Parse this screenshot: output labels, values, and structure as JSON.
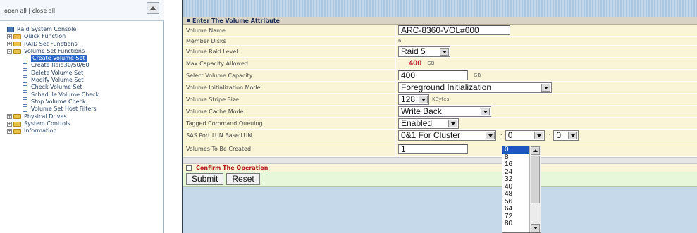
{
  "nav": {
    "open_all": "open all",
    "separator": "|",
    "close_all": "close all",
    "tree": [
      {
        "label": "Raid System Console",
        "type": "root",
        "icon": "computer-icon"
      },
      {
        "label": "Quick Function",
        "type": "folder",
        "expand": "+"
      },
      {
        "label": "RAID Set Functions",
        "type": "folder",
        "expand": "+"
      },
      {
        "label": "Volume Set Functions",
        "type": "folder",
        "expand": "-"
      },
      {
        "label": "Create Volume Set",
        "type": "page",
        "active": true
      },
      {
        "label": "Create Raid30/50/60",
        "type": "page"
      },
      {
        "label": "Delete Volume Set",
        "type": "page"
      },
      {
        "label": "Modify Volume Set",
        "type": "page"
      },
      {
        "label": "Check Volume Set",
        "type": "page"
      },
      {
        "label": "Schedule Volume Check",
        "type": "page"
      },
      {
        "label": "Stop Volume Check",
        "type": "page"
      },
      {
        "label": "Volume Set Host Filters",
        "type": "page"
      },
      {
        "label": "Physical Drives",
        "type": "folder",
        "expand": "+"
      },
      {
        "label": "System Controls",
        "type": "folder",
        "expand": "+"
      },
      {
        "label": "Information",
        "type": "folder",
        "expand": "+"
      }
    ]
  },
  "form": {
    "section_title": "Enter The Volume Attribute",
    "rows": {
      "volume_name": {
        "label": "Volume Name",
        "value": "ARC-8360-VOL#000"
      },
      "member_disks": {
        "label": "Member Disks",
        "value": "6"
      },
      "raid_level": {
        "label": "Volume Raid Level",
        "value": "Raid 5"
      },
      "max_capacity": {
        "label": "Max Capacity Allowed",
        "value": "400",
        "unit": "GB"
      },
      "select_capacity": {
        "label": "Select Volume Capacity",
        "value": "400",
        "unit": "GB"
      },
      "init_mode": {
        "label": "Volume Initialization Mode",
        "value": "Foreground Initialization"
      },
      "stripe_size": {
        "label": "Volume Stripe Size",
        "value": "128",
        "unit": "KBytes"
      },
      "cache_mode": {
        "label": "Volume Cache Mode",
        "value": "Write Back"
      },
      "tcq": {
        "label": "Tagged Command Queuing",
        "value": "Enabled"
      },
      "sas_port": {
        "label": "SAS Port:LUN Base:LUN",
        "port": "0&1 For Cluster",
        "sep1": ":",
        "lun_base": "0",
        "sep2": ":",
        "lun": "0"
      },
      "volumes_count": {
        "label": "Volumes To Be Created",
        "value": "1"
      }
    },
    "confirm_label": "Confirm The Operation",
    "submit_label": "Submit",
    "reset_label": "Reset"
  },
  "lun_base_dropdown": {
    "options": [
      "0",
      "8",
      "16",
      "24",
      "32",
      "40",
      "48",
      "56",
      "64",
      "72",
      "80"
    ],
    "selected": "0"
  },
  "colors": {
    "row_bg": "#faf5d6",
    "section_header_bg": "#d9d3c6",
    "max_capacity_color": "#c0152a",
    "confirm_color": "#b31b1b",
    "selection_blue": "#1e56c4",
    "right_frame_bg": "#c6d9ea"
  }
}
